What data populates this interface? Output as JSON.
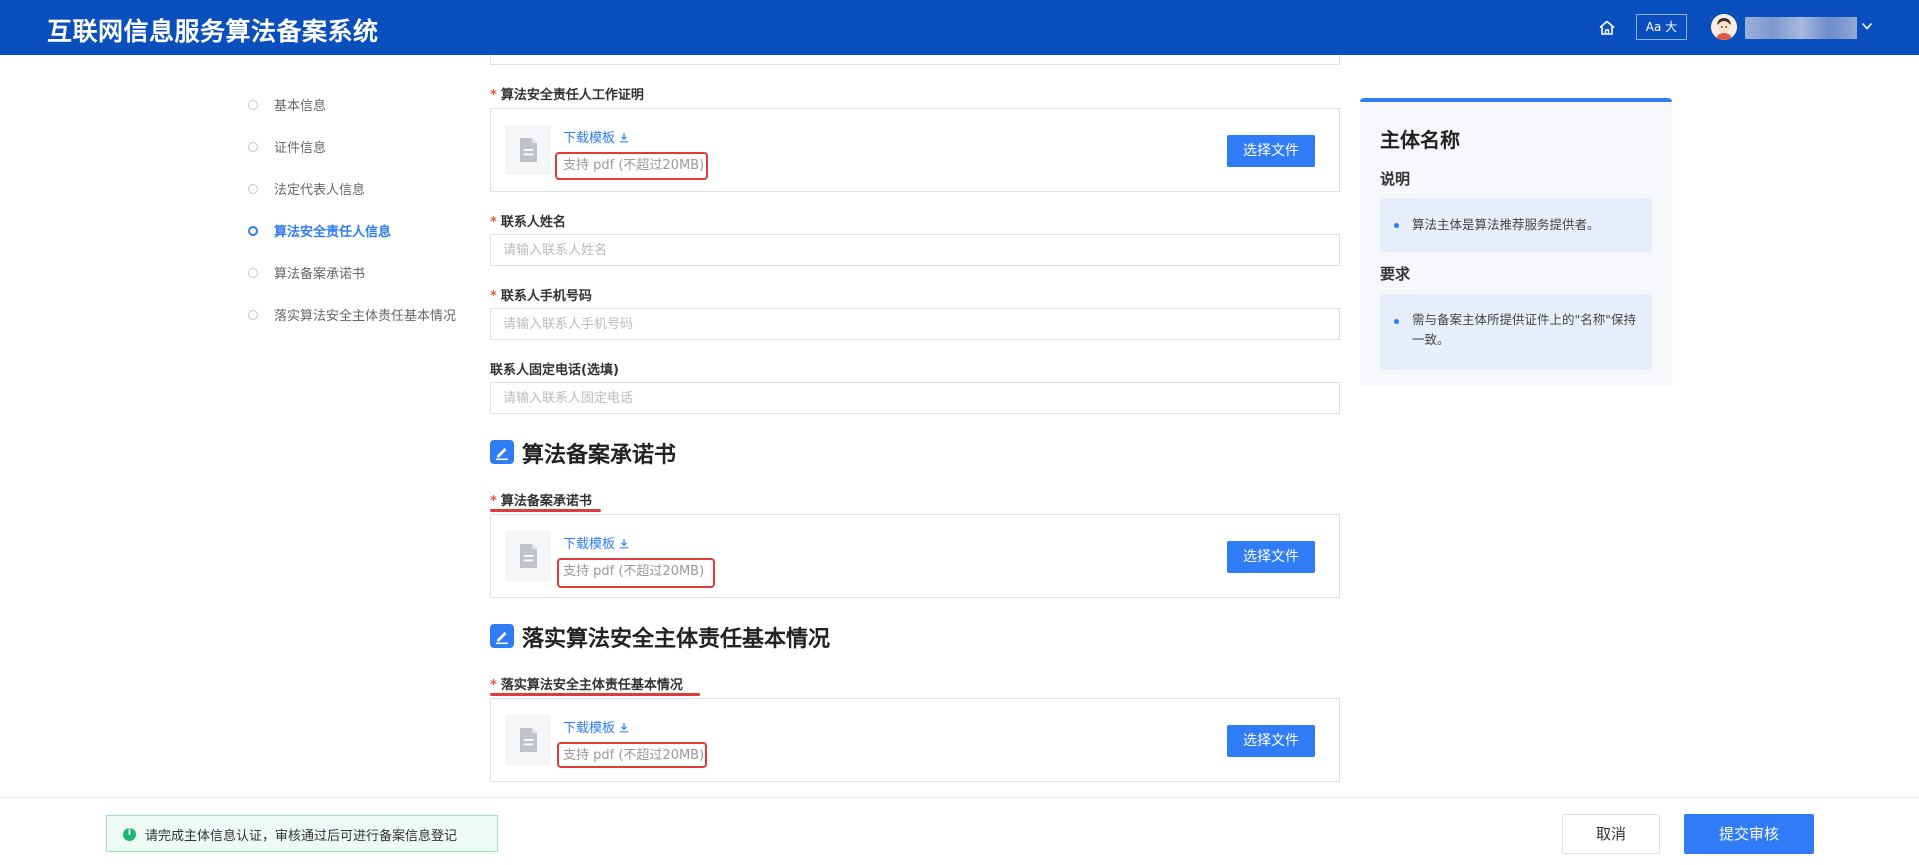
{
  "header": {
    "title": "互联网信息服务算法备案系统",
    "font_toggle_label": "Aa 大",
    "user_name": "",
    "icons": [
      "home-icon",
      "avatar",
      "chevron-down-icon"
    ]
  },
  "nav": {
    "items": [
      {
        "label": "基本信息",
        "active": false
      },
      {
        "label": "证件信息",
        "active": false
      },
      {
        "label": "法定代表人信息",
        "active": false
      },
      {
        "label": "算法安全责任人信息",
        "active": true
      },
      {
        "label": "算法备案承诺书",
        "active": false
      },
      {
        "label": "落实算法安全主体责任基本情况",
        "active": false
      }
    ]
  },
  "form": {
    "work_cert": {
      "required_mark": "*",
      "label": "算法安全责任人工作证明",
      "download_label": "下载模板",
      "hint": "支持 pdf (不超过20MB)",
      "button_label": "选择文件"
    },
    "contact_name": {
      "required_mark": "*",
      "label": "联系人姓名",
      "value": "",
      "placeholder": "请输入联系人姓名"
    },
    "contact_phone": {
      "required_mark": "*",
      "label": "联系人手机号码",
      "value": "",
      "placeholder": "请输入联系人手机号码"
    },
    "contact_landline": {
      "label": "联系人固定电话(选填)",
      "value": "",
      "placeholder": "请输入联系人固定电话"
    },
    "commitment_section": {
      "title": "算法备案承诺书",
      "required_mark": "*",
      "label": "算法备案承诺书",
      "download_label": "下载模板",
      "hint": "支持 pdf (不超过20MB)",
      "button_label": "选择文件"
    },
    "responsibility_section": {
      "title": "落实算法安全主体责任基本情况",
      "required_mark": "*",
      "label": "落实算法安全主体责任基本情况",
      "download_label": "下载模板",
      "hint": "支持 pdf (不超过20MB)",
      "button_label": "选择文件"
    }
  },
  "panel": {
    "title": "主体名称",
    "description_heading": "说明",
    "description_text": "算法主体是算法推荐服务提供者。",
    "requirement_heading": "要求",
    "requirement_text": "需与备案主体所提供证件上的\"名称\"保持一致。"
  },
  "footer": {
    "notice": "请完成主体信息认证，审核通过后可进行备案信息登记",
    "cancel_label": "取消",
    "submit_label": "提交审核"
  },
  "colors": {
    "header_bg": "#0a4fbe",
    "primary": "#2f7cf6",
    "required": "#f0533c",
    "annotation_red": "#e03a3a",
    "notice_green": "#21b573"
  }
}
